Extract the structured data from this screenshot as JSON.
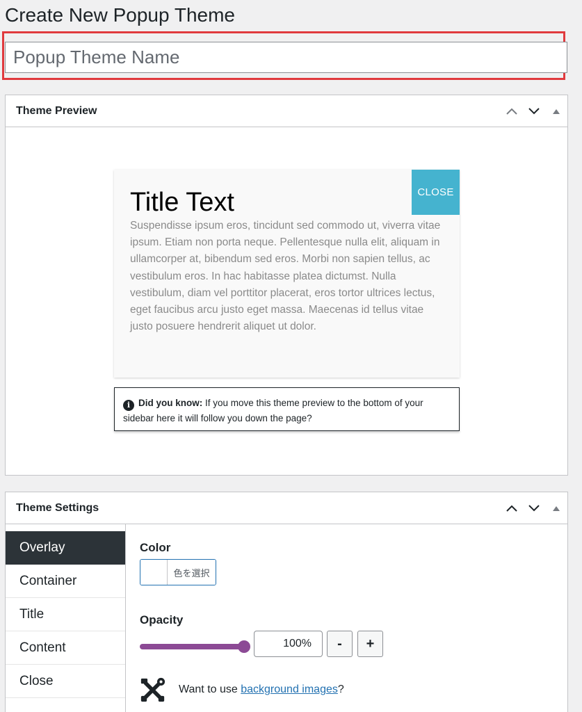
{
  "page": {
    "title": "Create New Popup Theme"
  },
  "name_field": {
    "placeholder": "Popup Theme Name",
    "value": ""
  },
  "preview_box": {
    "title": "Theme Preview",
    "popup": {
      "title": "Title Text",
      "content": "Suspendisse ipsum eros, tincidunt sed commodo ut, viverra vitae ipsum. Etiam non porta neque. Pellentesque nulla elit, aliquam in ullamcorper at, bibendum sed eros. Morbi non sapien tellus, ac vestibulum eros. In hac habitasse platea dictumst. Nulla vestibulum, diam vel porttitor placerat, eros tortor ultrices lectus, eget faucibus arcu justo eget massa. Maecenas id tellus vitae justo posuere hendrerit aliquet ut dolor.",
      "close_label": "CLOSE",
      "close_color": "#45b3cf"
    },
    "notice": {
      "bold": "Did you know:",
      "text": " If you move this theme preview to the bottom of your sidebar here it will follow you down the page?"
    }
  },
  "settings_box": {
    "title": "Theme Settings",
    "tabs": [
      {
        "label": "Overlay",
        "active": true
      },
      {
        "label": "Container",
        "active": false
      },
      {
        "label": "Title",
        "active": false
      },
      {
        "label": "Content",
        "active": false
      },
      {
        "label": "Close",
        "active": false
      }
    ],
    "overlay": {
      "color_label": "Color",
      "color_button_text": "色を選択",
      "opacity_label": "Opacity",
      "opacity_value": "100%",
      "opacity_level": 1.0,
      "minus_label": "-",
      "plus_label": "+",
      "bg_prefix": "Want to use ",
      "bg_link": "background images",
      "bg_suffix": "?"
    }
  },
  "colors": {
    "accent": "#8c4a95",
    "highlight_border": "#e03a3e",
    "active_tab": "#2c3338"
  },
  "icons": [
    "chevron-up-icon",
    "chevron-down-icon",
    "toggle-arrow-icon",
    "info-icon",
    "tools-icon"
  ]
}
